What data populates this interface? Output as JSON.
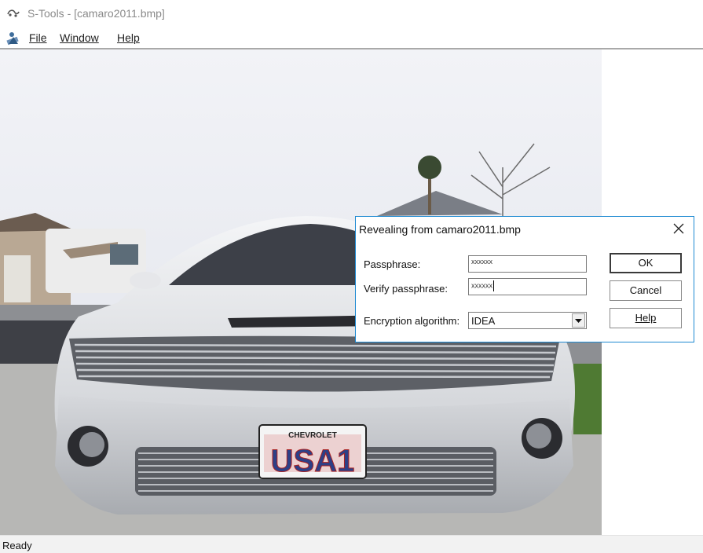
{
  "window": {
    "title": "S-Tools - [camaro2011.bmp]"
  },
  "menu": {
    "items": [
      {
        "label": "File"
      },
      {
        "label": "Window"
      },
      {
        "label": "Help"
      }
    ]
  },
  "status": {
    "text": "Ready"
  },
  "dialog": {
    "title": "Revealing from camaro2011.bmp",
    "passphrase": {
      "label": "Passphrase:",
      "value": "xxxxxx"
    },
    "verify": {
      "label": "Verify passphrase:",
      "value": "xxxxxx"
    },
    "algorithm": {
      "label": "Encryption algorithm:",
      "value": "IDEA"
    },
    "buttons": {
      "ok": "OK",
      "cancel": "Cancel",
      "help": "Help"
    }
  },
  "image": {
    "plate_top": "CHEVROLET",
    "plate_text": "USA1"
  },
  "colors": {
    "dialog_border": "#1f8ad2",
    "car_silver": "#c9ccd0",
    "sky": "#e6e8ee"
  },
  "icons": [
    "app-icon",
    "menu-app-icon",
    "close-icon",
    "dropdown-arrow-icon"
  ]
}
